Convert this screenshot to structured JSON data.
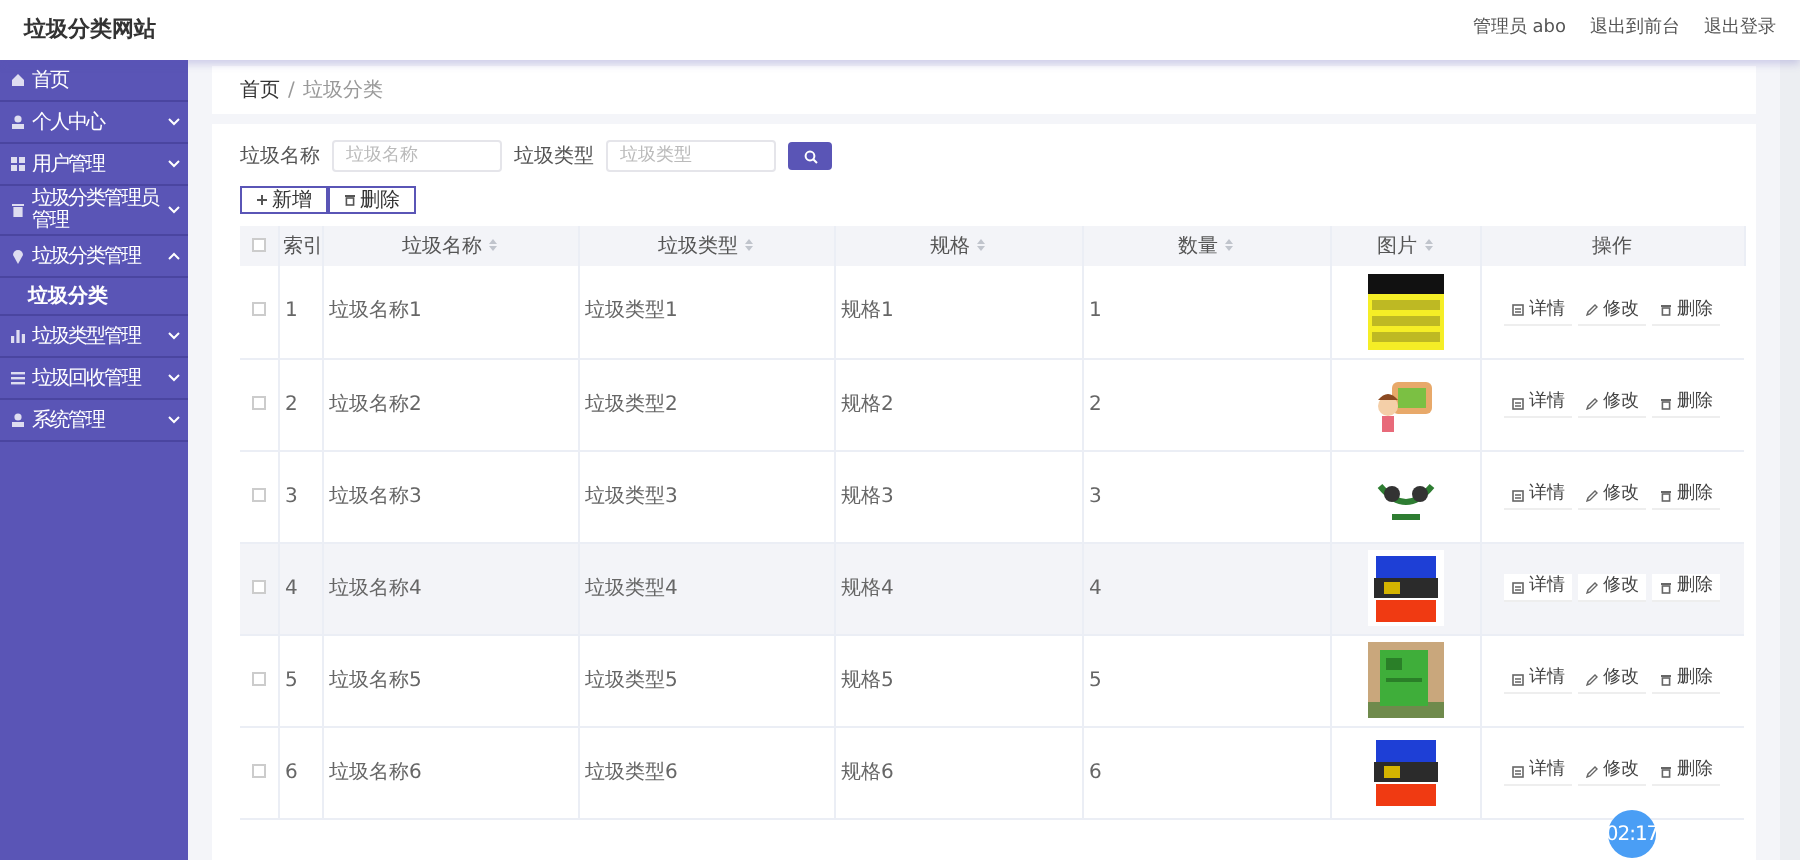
{
  "header": {
    "title": "垃圾分类网站",
    "links": [
      "管理员 abo",
      "退出到前台",
      "退出登录"
    ]
  },
  "sidebar": {
    "items": [
      {
        "label": "首页"
      },
      {
        "label": "个人中心",
        "expanded": false
      },
      {
        "label": "用户管理",
        "expanded": false
      },
      {
        "label": "垃圾分类管理员管理",
        "expanded": false
      },
      {
        "label": "垃圾分类管理",
        "expanded": true,
        "children": [
          {
            "label": "垃圾分类",
            "selected": true
          }
        ]
      },
      {
        "label": "垃圾类型管理",
        "expanded": false
      },
      {
        "label": "垃圾回收管理",
        "expanded": false
      },
      {
        "label": "系统管理",
        "expanded": false
      }
    ]
  },
  "breadcrumb": [
    "首页",
    "/",
    "垃圾分类"
  ],
  "search": {
    "fields": [
      {
        "label": "垃圾名称",
        "placeholder": "垃圾名称"
      },
      {
        "label": "垃圾类型",
        "placeholder": "垃圾类型"
      }
    ]
  },
  "actions": [
    {
      "label": "新增",
      "kind": "add"
    },
    {
      "label": "删除",
      "kind": "delete"
    }
  ],
  "table": {
    "all_checked": false,
    "columns": [
      {
        "label": "索引",
        "sortable": false
      },
      {
        "label": "垃圾名称",
        "sortable": true
      },
      {
        "label": "垃圾类型",
        "sortable": true
      },
      {
        "label": "规格",
        "sortable": true
      },
      {
        "label": "数量",
        "sortable": true
      },
      {
        "label": "图片",
        "sortable": true
      },
      {
        "label": "操作",
        "sortable": false
      }
    ],
    "rows": [
      {
        "index": "1",
        "name": "垃圾名称1",
        "type": "垃圾类型1",
        "spec": "规格1",
        "qty": "1",
        "checked": false,
        "hovered": false,
        "ops": [
          "详情",
          "修改",
          "删除"
        ]
      },
      {
        "index": "2",
        "name": "垃圾名称2",
        "type": "垃圾类型2",
        "spec": "规格2",
        "qty": "2",
        "checked": false,
        "hovered": false,
        "ops": [
          "详情",
          "修改",
          "删除"
        ]
      },
      {
        "index": "3",
        "name": "垃圾名称3",
        "type": "垃圾类型3",
        "spec": "规格3",
        "qty": "3",
        "checked": false,
        "hovered": false,
        "ops": [
          "详情",
          "修改",
          "删除"
        ]
      },
      {
        "index": "4",
        "name": "垃圾名称4",
        "type": "垃圾类型4",
        "spec": "规格4",
        "qty": "4",
        "checked": false,
        "hovered": true,
        "ops": [
          "详情",
          "修改",
          "删除"
        ]
      },
      {
        "index": "5",
        "name": "垃圾名称5",
        "type": "垃圾类型5",
        "spec": "规格5",
        "qty": "5",
        "checked": false,
        "hovered": false,
        "ops": [
          "详情",
          "修改",
          "删除"
        ]
      },
      {
        "index": "6",
        "name": "垃圾名称6",
        "type": "垃圾类型6",
        "spec": "规格6",
        "qty": "6",
        "checked": false,
        "hovered": false,
        "ops": [
          "详情",
          "修改",
          "删除"
        ]
      }
    ]
  },
  "timer_badge": "02:17"
}
